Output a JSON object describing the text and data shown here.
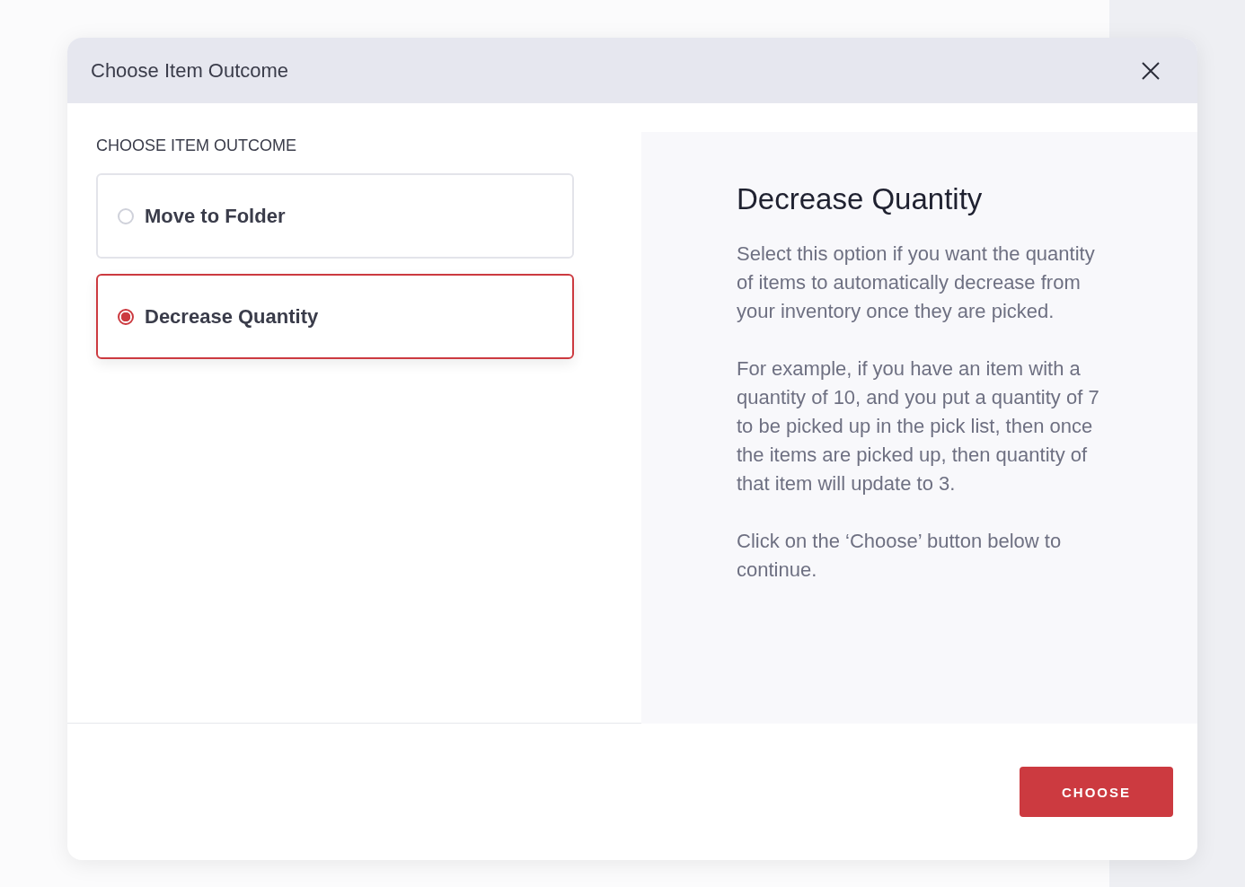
{
  "dialog": {
    "title": "Choose Item Outcome",
    "section_label": "CHOOSE ITEM OUTCOME",
    "options": [
      {
        "label": "Move to Folder",
        "selected": false
      },
      {
        "label": "Decrease Quantity",
        "selected": true
      }
    ],
    "description": {
      "heading": "Decrease Quantity",
      "paragraphs": [
        "Select this option if you want the quantity of items to automatically decrease from your inventory once they are picked.",
        "For example, if you have an item with a quantity of 10, and you put a quantity of 7 to be picked up in the pick list, then once the items are picked up, then quantity of that item will update to 3.",
        "Click on the ‘Choose’ button below to continue."
      ]
    },
    "button": "CHOOSE"
  }
}
